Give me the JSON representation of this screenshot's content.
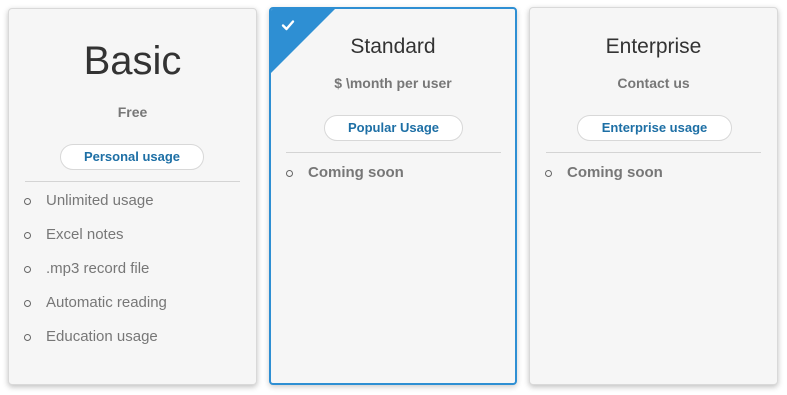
{
  "plans": [
    {
      "title": "Basic",
      "price": "Free",
      "button": "Personal usage",
      "features": [
        "Unlimited usage",
        "Excel notes",
        ".mp3 record file",
        "Automatic reading",
        "Education usage"
      ]
    },
    {
      "title": "Standard",
      "price": "$ \\month per user",
      "button": "Popular Usage",
      "selected": true,
      "features": [
        "Coming soon"
      ]
    },
    {
      "title": "Enterprise",
      "price": "Contact us",
      "button": "Enterprise usage",
      "features": [
        "Coming soon"
      ]
    }
  ],
  "colors": {
    "accent": "#2e8fd3",
    "button_text": "#1d6fa5",
    "card_bg": "#f6f6f6",
    "muted_text": "#777777"
  },
  "icons": {
    "selected_marker": "checkmark-icon",
    "list_bullet": "circle-bullet-icon"
  }
}
